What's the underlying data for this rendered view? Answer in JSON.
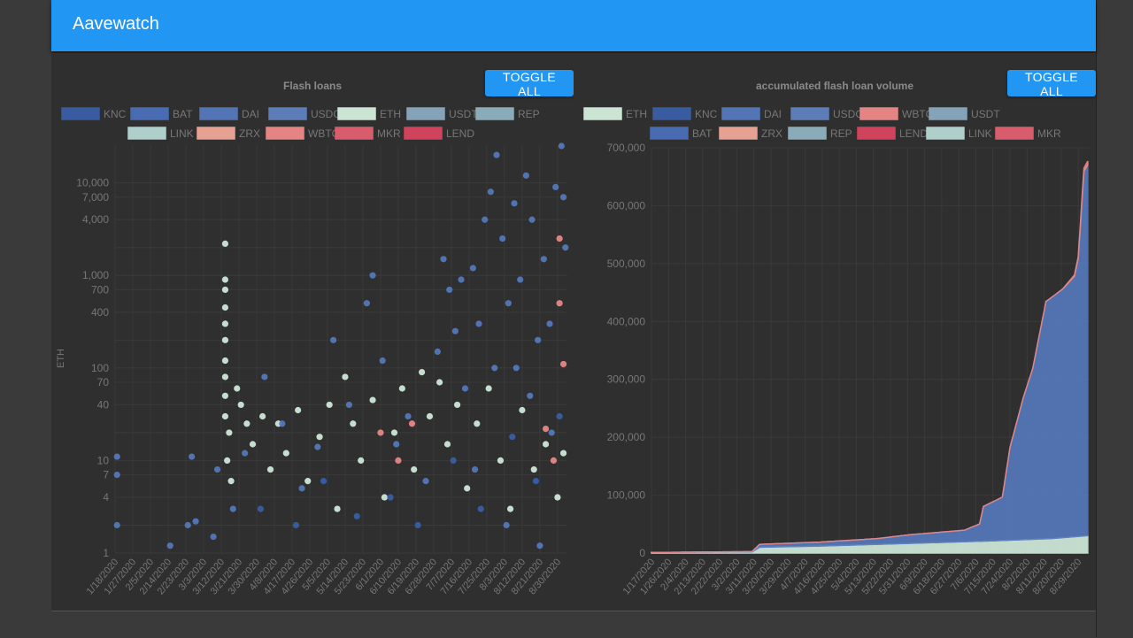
{
  "app": {
    "title": "Aavewatch"
  },
  "toggle_label": "TOGGLE ALL",
  "chart_data": [
    {
      "type": "scatter",
      "title": "Flash loans",
      "ylabel": "ETH",
      "yscale": "log",
      "ylim": [
        1,
        25000
      ],
      "yticks": [
        1,
        2,
        4,
        7,
        10,
        20,
        40,
        70,
        100,
        200,
        400,
        700,
        1000,
        2000,
        4000,
        7000,
        10000
      ],
      "ytick_labels": [
        "1",
        "",
        "4",
        "7",
        "10",
        "",
        "40",
        "70",
        "100",
        "",
        "400",
        "700",
        "1,000",
        "",
        "4,000",
        "7,000",
        "10,000"
      ],
      "x_range": [
        "1/18/2020",
        "9/4/2020"
      ],
      "xticks": [
        "1/18/2020",
        "1/27/2020",
        "2/5/2020",
        "2/14/2020",
        "2/23/2020",
        "3/3/2020",
        "3/12/2020",
        "3/21/2020",
        "3/30/2020",
        "4/8/2020",
        "4/17/2020",
        "4/26/2020",
        "5/5/2020",
        "5/14/2020",
        "5/23/2020",
        "6/1/2020",
        "6/10/2020",
        "6/19/2020",
        "6/28/2020",
        "7/7/2020",
        "7/16/2020",
        "7/25/2020",
        "8/3/2020",
        "8/12/2020",
        "8/21/2020",
        "8/30/2020"
      ],
      "legend_placement": "top",
      "legend": [
        {
          "name": "KNC",
          "color": "#3a5fa8"
        },
        {
          "name": "BAT",
          "color": "#4a6fb8"
        },
        {
          "name": "DAI",
          "color": "#5579bd"
        },
        {
          "name": "USDC",
          "color": "#5f82bf"
        },
        {
          "name": "ETH",
          "color": "#d4eedd"
        },
        {
          "name": "USDT",
          "color": "#8aaac0"
        },
        {
          "name": "REP",
          "color": "#8fb3c0"
        },
        {
          "name": "LINK",
          "color": "#b5d8d3"
        },
        {
          "name": "ZRX",
          "color": "#f0a898"
        },
        {
          "name": "WBTC",
          "color": "#ee8a88"
        },
        {
          "name": "MKR",
          "color": "#e26070"
        },
        {
          "name": "LEND",
          "color": "#d94560"
        }
      ],
      "series": [
        {
          "name": "ETH",
          "color": "#d4eedd",
          "points": [
            [
              "3/14/2020",
              2200
            ],
            [
              "3/14/2020",
              900
            ],
            [
              "3/14/2020",
              700
            ],
            [
              "3/14/2020",
              450
            ],
            [
              "3/14/2020",
              300
            ],
            [
              "3/14/2020",
              200
            ],
            [
              "3/14/2020",
              120
            ],
            [
              "3/14/2020",
              80
            ],
            [
              "3/14/2020",
              50
            ],
            [
              "3/14/2020",
              30
            ],
            [
              "3/16/2020",
              20
            ],
            [
              "3/15/2020",
              10
            ],
            [
              "3/17/2020",
              6
            ],
            [
              "3/20/2020",
              60
            ],
            [
              "3/22/2020",
              40
            ],
            [
              "3/25/2020",
              25
            ],
            [
              "3/28/2020",
              15
            ],
            [
              "4/2/2020",
              30
            ],
            [
              "4/6/2020",
              8
            ],
            [
              "4/10/2020",
              25
            ],
            [
              "4/14/2020",
              12
            ],
            [
              "4/20/2020",
              35
            ],
            [
              "4/25/2020",
              6
            ],
            [
              "5/1/2020",
              18
            ],
            [
              "5/6/2020",
              40
            ],
            [
              "5/10/2020",
              3
            ],
            [
              "5/14/2020",
              80
            ],
            [
              "5/18/2020",
              25
            ],
            [
              "5/22/2020",
              10
            ],
            [
              "5/28/2020",
              45
            ],
            [
              "6/3/2020",
              4
            ],
            [
              "6/8/2020",
              20
            ],
            [
              "6/12/2020",
              60
            ],
            [
              "6/18/2020",
              8
            ],
            [
              "6/22/2020",
              90
            ],
            [
              "6/26/2020",
              30
            ],
            [
              "7/1/2020",
              70
            ],
            [
              "7/5/2020",
              15
            ],
            [
              "7/10/2020",
              40
            ],
            [
              "7/15/2020",
              5
            ],
            [
              "7/20/2020",
              25
            ],
            [
              "7/26/2020",
              60
            ],
            [
              "8/1/2020",
              10
            ],
            [
              "8/6/2020",
              3
            ],
            [
              "8/12/2020",
              35
            ],
            [
              "8/18/2020",
              8
            ],
            [
              "8/24/2020",
              15
            ],
            [
              "8/30/2020",
              4
            ],
            [
              "9/2/2020",
              12
            ]
          ]
        },
        {
          "name": "DAI",
          "color": "#5579bd",
          "points": [
            [
              "1/19/2020",
              11
            ],
            [
              "1/19/2020",
              7
            ],
            [
              "1/19/2020",
              2
            ],
            [
              "2/15/2020",
              1.2
            ],
            [
              "2/24/2020",
              2
            ],
            [
              "2/26/2020",
              11
            ],
            [
              "2/28/2020",
              2.2
            ],
            [
              "3/8/2020",
              1.5
            ],
            [
              "3/10/2020",
              8
            ],
            [
              "3/18/2020",
              3
            ],
            [
              "3/24/2020",
              12
            ],
            [
              "4/3/2020",
              80
            ],
            [
              "4/12/2020",
              25
            ],
            [
              "4/22/2020",
              5
            ],
            [
              "4/30/2020",
              14
            ],
            [
              "5/8/2020",
              200
            ],
            [
              "5/16/2020",
              40
            ],
            [
              "5/25/2020",
              500
            ],
            [
              "5/28/2020",
              1000
            ],
            [
              "6/2/2020",
              120
            ],
            [
              "6/9/2020",
              15
            ],
            [
              "6/15/2020",
              30
            ],
            [
              "6/24/2020",
              6
            ],
            [
              "6/30/2020",
              150
            ],
            [
              "7/3/2020",
              1500
            ],
            [
              "7/6/2020",
              700
            ],
            [
              "7/9/2020",
              250
            ],
            [
              "7/12/2020",
              900
            ],
            [
              "7/14/2020",
              60
            ],
            [
              "7/18/2020",
              1200
            ],
            [
              "7/21/2020",
              300
            ],
            [
              "7/24/2020",
              4000
            ],
            [
              "7/27/2020",
              8000
            ],
            [
              "7/30/2020",
              20000
            ],
            [
              "8/2/2020",
              2500
            ],
            [
              "8/5/2020",
              500
            ],
            [
              "8/8/2020",
              6000
            ],
            [
              "8/11/2020",
              900
            ],
            [
              "8/14/2020",
              12000
            ],
            [
              "8/17/2020",
              4000
            ],
            [
              "8/20/2020",
              200
            ],
            [
              "8/23/2020",
              1500
            ],
            [
              "8/26/2020",
              300
            ],
            [
              "8/29/2020",
              9000
            ],
            [
              "9/1/2020",
              25000
            ],
            [
              "9/2/2020",
              7000
            ],
            [
              "9/3/2020",
              2000
            ],
            [
              "8/9/2020",
              100
            ],
            [
              "8/16/2020",
              50
            ],
            [
              "8/27/2020",
              20
            ],
            [
              "7/29/2020",
              100
            ],
            [
              "7/19/2020",
              8
            ],
            [
              "8/4/2020",
              2
            ],
            [
              "8/21/2020",
              1.2
            ]
          ]
        },
        {
          "name": "KNC",
          "color": "#3a5fa8",
          "points": [
            [
              "4/1/2020",
              3
            ],
            [
              "4/19/2020",
              2
            ],
            [
              "5/3/2020",
              6
            ],
            [
              "5/20/2020",
              2.5
            ],
            [
              "6/6/2020",
              4
            ],
            [
              "6/20/2020",
              2
            ],
            [
              "7/8/2020",
              10
            ],
            [
              "7/22/2020",
              3
            ],
            [
              "8/7/2020",
              18
            ],
            [
              "8/19/2020",
              6
            ],
            [
              "8/31/2020",
              30
            ]
          ]
        },
        {
          "name": "WBTC",
          "color": "#ee8a88",
          "points": [
            [
              "6/1/2020",
              20
            ],
            [
              "6/10/2020",
              10
            ],
            [
              "6/17/2020",
              25
            ],
            [
              "8/24/2020",
              22
            ],
            [
              "8/31/2020",
              2500
            ],
            [
              "8/31/2020",
              500
            ],
            [
              "9/2/2020",
              110
            ],
            [
              "8/28/2020",
              10
            ]
          ]
        }
      ]
    },
    {
      "type": "area",
      "stacked": true,
      "title": "accumulated flash loan volume",
      "ylim": [
        0,
        700000
      ],
      "yticks": [
        0,
        100000,
        200000,
        300000,
        400000,
        500000,
        600000,
        700000
      ],
      "ytick_labels": [
        "0",
        "100,000",
        "200,000",
        "300,000",
        "400,000",
        "500,000",
        "600,000",
        "700,000"
      ],
      "x_range": [
        "1/17/2020",
        "9/4/2020"
      ],
      "xticks": [
        "1/17/2020",
        "1/26/2020",
        "2/4/2020",
        "2/13/2020",
        "2/22/2020",
        "3/2/2020",
        "3/11/2020",
        "3/20/2020",
        "3/29/2020",
        "4/7/2020",
        "4/16/2020",
        "4/25/2020",
        "5/4/2020",
        "5/13/2020",
        "5/22/2020",
        "5/31/2020",
        "6/9/2020",
        "6/18/2020",
        "6/27/2020",
        "7/6/2020",
        "7/15/2020",
        "7/24/2020",
        "8/2/2020",
        "8/11/2020",
        "8/20/2020",
        "8/29/2020"
      ],
      "legend_placement": "top",
      "legend": [
        {
          "name": "ETH",
          "color": "#d4eedd"
        },
        {
          "name": "KNC",
          "color": "#3a5fa8"
        },
        {
          "name": "DAI",
          "color": "#5579bd"
        },
        {
          "name": "USDC",
          "color": "#5f82bf"
        },
        {
          "name": "WBTC",
          "color": "#ee8a88"
        },
        {
          "name": "USDT",
          "color": "#8aaac0"
        },
        {
          "name": "BAT",
          "color": "#4a6fb8"
        },
        {
          "name": "ZRX",
          "color": "#f0a898"
        },
        {
          "name": "REP",
          "color": "#8fb3c0"
        },
        {
          "name": "LEND",
          "color": "#d94560"
        },
        {
          "name": "LINK",
          "color": "#b5d8d3"
        },
        {
          "name": "MKR",
          "color": "#e26070"
        }
      ],
      "series": [
        {
          "name": "ETH",
          "color": "#d4eedd",
          "points": [
            [
              "1/17/2020",
              1000
            ],
            [
              "3/10/2020",
              2000
            ],
            [
              "3/14/2020",
              10000
            ],
            [
              "4/15/2020",
              12000
            ],
            [
              "5/15/2020",
              15000
            ],
            [
              "6/15/2020",
              18000
            ],
            [
              "7/15/2020",
              21000
            ],
            [
              "8/15/2020",
              25000
            ],
            [
              "9/3/2020",
              30000
            ]
          ]
        },
        {
          "name": "DAI",
          "color": "#5579bd",
          "points": [
            [
              "1/17/2020",
              0
            ],
            [
              "3/10/2020",
              500
            ],
            [
              "3/14/2020",
              5000
            ],
            [
              "4/15/2020",
              7000
            ],
            [
              "5/15/2020",
              10000
            ],
            [
              "6/1/2020",
              15000
            ],
            [
              "6/30/2020",
              20000
            ],
            [
              "7/8/2020",
              30000
            ],
            [
              "7/10/2020",
              60000
            ],
            [
              "7/20/2020",
              75000
            ],
            [
              "7/24/2020",
              160000
            ],
            [
              "7/31/2020",
              245000
            ],
            [
              "8/5/2020",
              295000
            ],
            [
              "8/12/2020",
              410000
            ],
            [
              "8/21/2020",
              430000
            ],
            [
              "8/27/2020",
              450000
            ],
            [
              "8/29/2020",
              480000
            ],
            [
              "9/1/2020",
              630000
            ],
            [
              "9/3/2020",
              640000
            ]
          ]
        },
        {
          "name": "WBTC",
          "color": "#ee8a88",
          "points": [
            [
              "1/17/2020",
              0
            ],
            [
              "8/20/2020",
              0
            ],
            [
              "8/29/2020",
              3000
            ],
            [
              "9/3/2020",
              7000
            ]
          ]
        }
      ]
    }
  ]
}
